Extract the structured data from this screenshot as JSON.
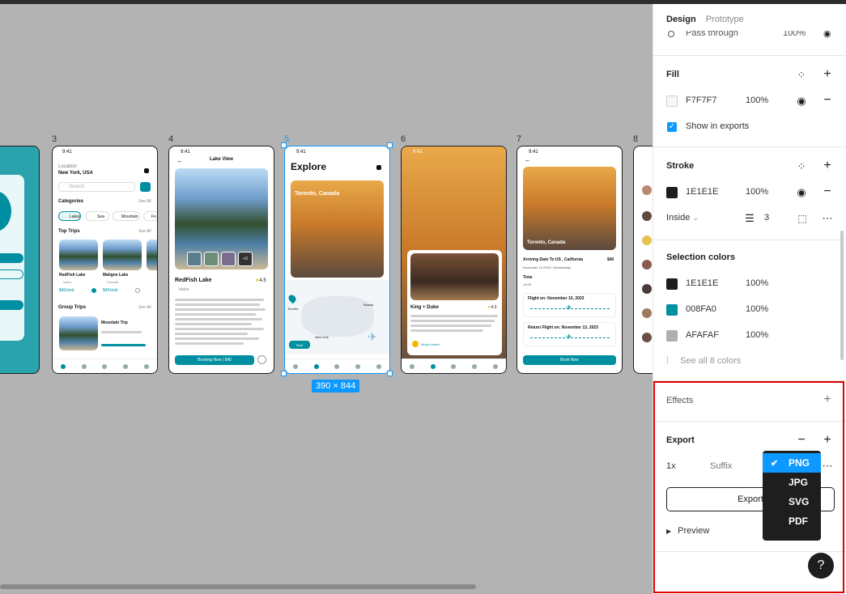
{
  "canvas": {
    "frames": [
      {
        "num": "3"
      },
      {
        "num": "4"
      },
      {
        "num": "5"
      },
      {
        "num": "6"
      },
      {
        "num": "7"
      },
      {
        "num": "8"
      }
    ],
    "selection_size": "390 × 844",
    "frame3": {
      "time": "9:41",
      "location_label": "Location",
      "location": "New York, USA",
      "search": "Search",
      "categories": "Categories",
      "see_all": "See All",
      "chips": [
        "Lakes",
        "Sea",
        "Mountain",
        "Fo"
      ],
      "top_trips": "Top Trips",
      "trip1": "RedFish Lake",
      "trip1_loc": "Idaho",
      "trip1_price": "$40/visit",
      "trip2": "Maligne Lake",
      "trip2_loc": "Canada",
      "trip2_price": "$40/visit",
      "group_trips": "Group Trips",
      "group1": "Mountain Trip"
    },
    "frame4": {
      "time": "9:41",
      "header": "Lake View",
      "title": "RedFish Lake",
      "rating": "4.5",
      "loc": "Idaho",
      "more": "+3",
      "cta": "Booking Now | $40"
    },
    "frame5": {
      "time": "9:41",
      "title": "Explore",
      "card_title": "Toronto, Canada",
      "map_labels": [
        "Toronto",
        "Russia",
        "New York"
      ],
      "start": "Start"
    },
    "frame6": {
      "time": "9:41",
      "card_title": "King + Duke",
      "rating": "4.3",
      "user": "Micky Irnieck"
    },
    "frame7": {
      "time": "9:41",
      "img_label": "Toronto, Canada",
      "heading": "Arriving Date To US , California",
      "price": "$40",
      "date": "November 10,2023 • Wednesday",
      "time_label": "Time",
      "time_val": "14:00",
      "flight1": "Flight on: November 10, 2023",
      "flight2": "Return Flight on: November 13, 2023",
      "cta": "Book Now"
    }
  },
  "panel": {
    "tabs": {
      "design": "Design",
      "prototype": "Prototype"
    },
    "layer": {
      "mode": "Pass through",
      "opacity": "100%"
    },
    "fill": {
      "title": "Fill",
      "hex": "F7F7F7",
      "opacity": "100%",
      "color": "#F7F7F7",
      "show_in_exports": "Show in exports"
    },
    "stroke": {
      "title": "Stroke",
      "hex": "1E1E1E",
      "opacity": "100%",
      "color": "#1E1E1E",
      "position": "Inside",
      "weight": "3"
    },
    "selection_colors": {
      "title": "Selection colors",
      "colors": [
        {
          "hex": "1E1E1E",
          "opacity": "100%",
          "color": "#1E1E1E"
        },
        {
          "hex": "008FA0",
          "opacity": "100%",
          "color": "#008FA0"
        },
        {
          "hex": "AFAFAF",
          "opacity": "100%",
          "color": "#AFAFAF"
        }
      ],
      "see_all": "See all 8 colors"
    },
    "effects": {
      "title": "Effects"
    },
    "export": {
      "title": "Export",
      "scale": "1x",
      "suffix_placeholder": "Suffix",
      "button": "Export",
      "preview": "Preview",
      "formats": [
        "PNG",
        "JPG",
        "SVG",
        "PDF"
      ],
      "selected_format": "PNG"
    },
    "help": "?"
  }
}
